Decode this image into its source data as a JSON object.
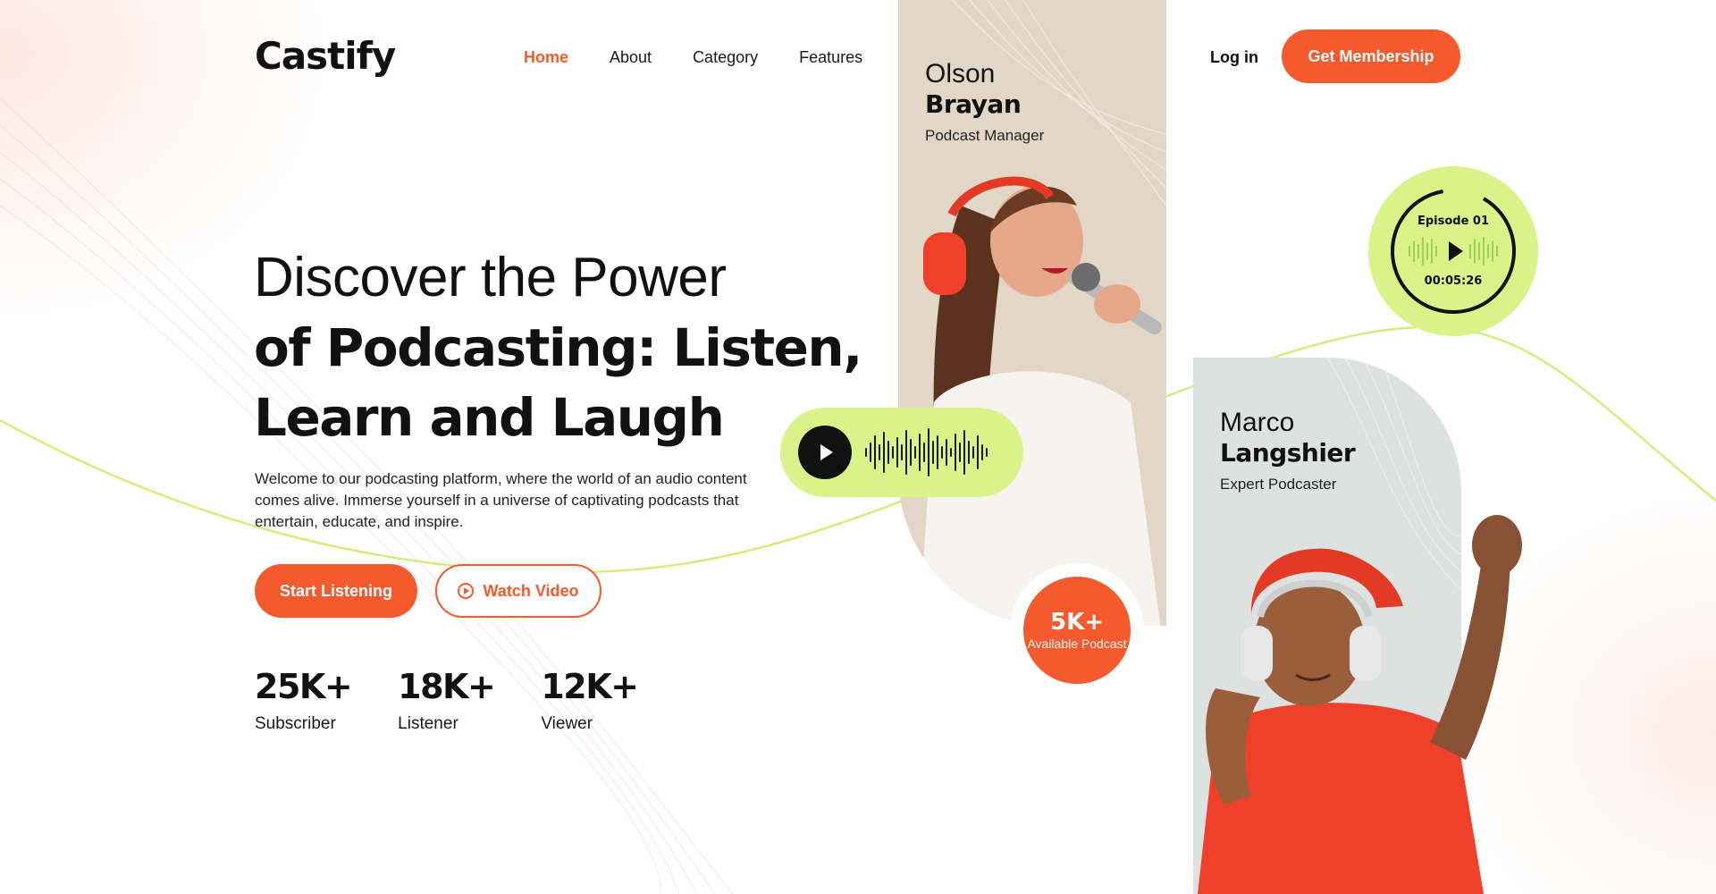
{
  "brand": {
    "name": "Castify",
    "accent": "#f45a2d",
    "lime": "#d9f38a"
  },
  "nav": {
    "items": [
      {
        "label": "Home",
        "active": true
      },
      {
        "label": "About",
        "active": false
      },
      {
        "label": "Category",
        "active": false
      },
      {
        "label": "Features",
        "active": false
      }
    ]
  },
  "header": {
    "login_label": "Log in",
    "membership_label": "Get Membership"
  },
  "hero": {
    "title_line1": "Discover the Power",
    "title_line2": "of Podcasting: Listen,",
    "title_line3": "Learn and Laugh",
    "description": "Welcome to our podcasting platform, where the world of an audio content comes alive. Immerse yourself in a universe of captivating podcasts that entertain, educate, and inspire.",
    "start_label": "Start Listening",
    "video_label": "Watch Video",
    "video_icon": "play-circle-icon"
  },
  "stats": [
    {
      "value": "25K+",
      "label": "Subscriber"
    },
    {
      "value": "18K+",
      "label": "Listener"
    },
    {
      "value": "12K+",
      "label": "Viewer"
    }
  ],
  "cards": [
    {
      "first_name": "Olson",
      "last_name": "Brayan",
      "role": "Podcast Manager",
      "bg": "#e2d7c7"
    },
    {
      "first_name": "Marco",
      "last_name": "Langshier",
      "role": "Expert Podcaster",
      "bg": "#dde1e0"
    }
  ],
  "badge": {
    "value": "5K+",
    "label": "Available Podcast"
  },
  "episode": {
    "title": "Episode 01",
    "time": "00:05:26",
    "icon": "play-icon"
  },
  "audio_player": {
    "icon": "play-icon"
  }
}
